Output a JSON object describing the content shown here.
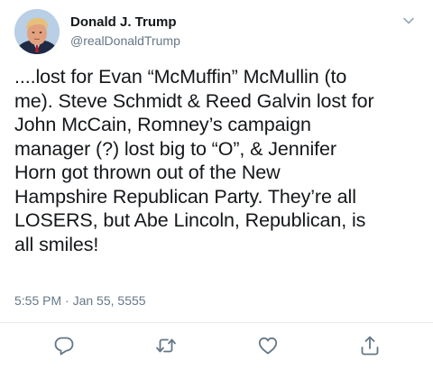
{
  "user": {
    "name": "Donald J. Trump",
    "handle": "@realDonaldTrump"
  },
  "tweet": {
    "text": "....lost for Evan “McMuffin” McMullin (to\nme). Steve Schmidt & Reed Galvin lost for\nJohn McCain, Romney’s campaign\nmanager (?) lost big to “O”, & Jennifer\nHorn got thrown out of the New\nHampshire Republican Party. They’re all\nLOSERS, but Abe Lincoln, Republican, is\nall smiles!",
    "time": "5:55 PM",
    "separator": "·",
    "date": "Jan 55, 5555"
  },
  "icons": {
    "menu": "chevron-down-icon",
    "reply": "reply-icon",
    "retweet": "retweet-icon",
    "like": "heart-icon",
    "share": "share-icon"
  },
  "colors": {
    "text": "#14171a",
    "secondary": "#657786",
    "icon": "#657786",
    "divider": "#e6ecf0"
  }
}
